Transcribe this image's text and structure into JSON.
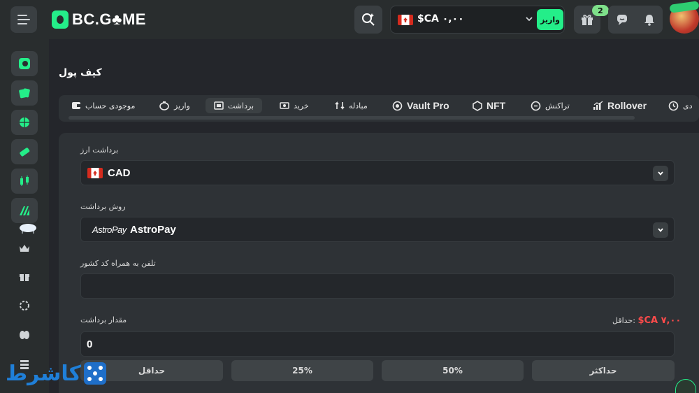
{
  "header": {
    "logo_text": "BC.G♣ME",
    "balance_currency": "$CA",
    "balance_amount": "$CA ۰,۰۰",
    "deposit_label": "واریز",
    "gift_badge_count": "2"
  },
  "page": {
    "title": "کیف پول"
  },
  "tabs": [
    {
      "label": "موجودی حساب",
      "icon": "wallet-icon"
    },
    {
      "label": "واریز",
      "icon": "piggy-bank-icon"
    },
    {
      "label": "برداشت",
      "icon": "withdraw-icon",
      "active": true
    },
    {
      "label": "خرید",
      "icon": "cash-icon"
    },
    {
      "label": "مبادله",
      "icon": "swap-icon"
    },
    {
      "label": "Vault Pro",
      "icon": "vault-icon"
    },
    {
      "label": "NFT",
      "icon": "nft-icon"
    },
    {
      "label": "تراکنش",
      "icon": "transaction-icon"
    },
    {
      "label": "Rollover",
      "icon": "chart-icon"
    },
    {
      "label": "دی",
      "icon": "clock-icon"
    }
  ],
  "form": {
    "currency_label": "برداشت ارز",
    "currency_value": "CAD",
    "method_label": "روش برداشت",
    "method_logo": "AstroPay",
    "method_value": "AstroPay",
    "phone_label": "تلفن به همراه کد کشور",
    "phone_value": "",
    "amount_label": "مقدار برداشت",
    "min_label": "حداقل:",
    "min_value": "$CA ۷,۰۰",
    "amount_value": "0",
    "quick_buttons": [
      "حداقل",
      "25%",
      "50%",
      "حداکثر"
    ]
  },
  "watermark": {
    "text": "کاشرط"
  },
  "colors": {
    "accent": "#24ee89",
    "background": "#24262b",
    "panel": "#2e3236",
    "danger": "#ff4b4b"
  }
}
